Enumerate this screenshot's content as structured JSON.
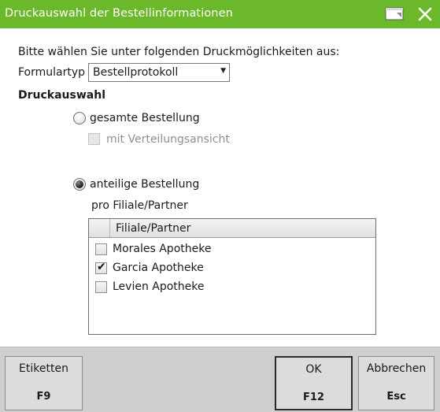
{
  "window": {
    "title": "Druckauswahl der Bestellinformationen",
    "accent": "#6bb92a"
  },
  "form": {
    "intro": "Bitte wählen Sie unter folgenden Druckmöglichkeiten aus:",
    "formulartyp_label": "Formulartyp",
    "formulartyp_value": "Bestellprotokoll",
    "section_title": "Druckauswahl",
    "option_gesamt": "gesamte Bestellung",
    "option_verteilung": "mit Verteilungsansicht",
    "option_anteilig": "anteilige Bestellung",
    "sub_label": "pro Filiale/Partner",
    "selected_option": "anteilige Bestellung"
  },
  "grid": {
    "column": "Filiale/Partner",
    "rows": [
      {
        "name": "Morales Apotheke",
        "checked": false
      },
      {
        "name": "Garcia Apotheke",
        "checked": true
      },
      {
        "name": "Levien Apotheke",
        "checked": false
      }
    ]
  },
  "footer": {
    "etiketten": {
      "label": "Etiketten",
      "key": "F9"
    },
    "ok": {
      "label": "OK",
      "key": "F12"
    },
    "abbrechen": {
      "label": "Abbrechen",
      "key": "Esc"
    }
  }
}
